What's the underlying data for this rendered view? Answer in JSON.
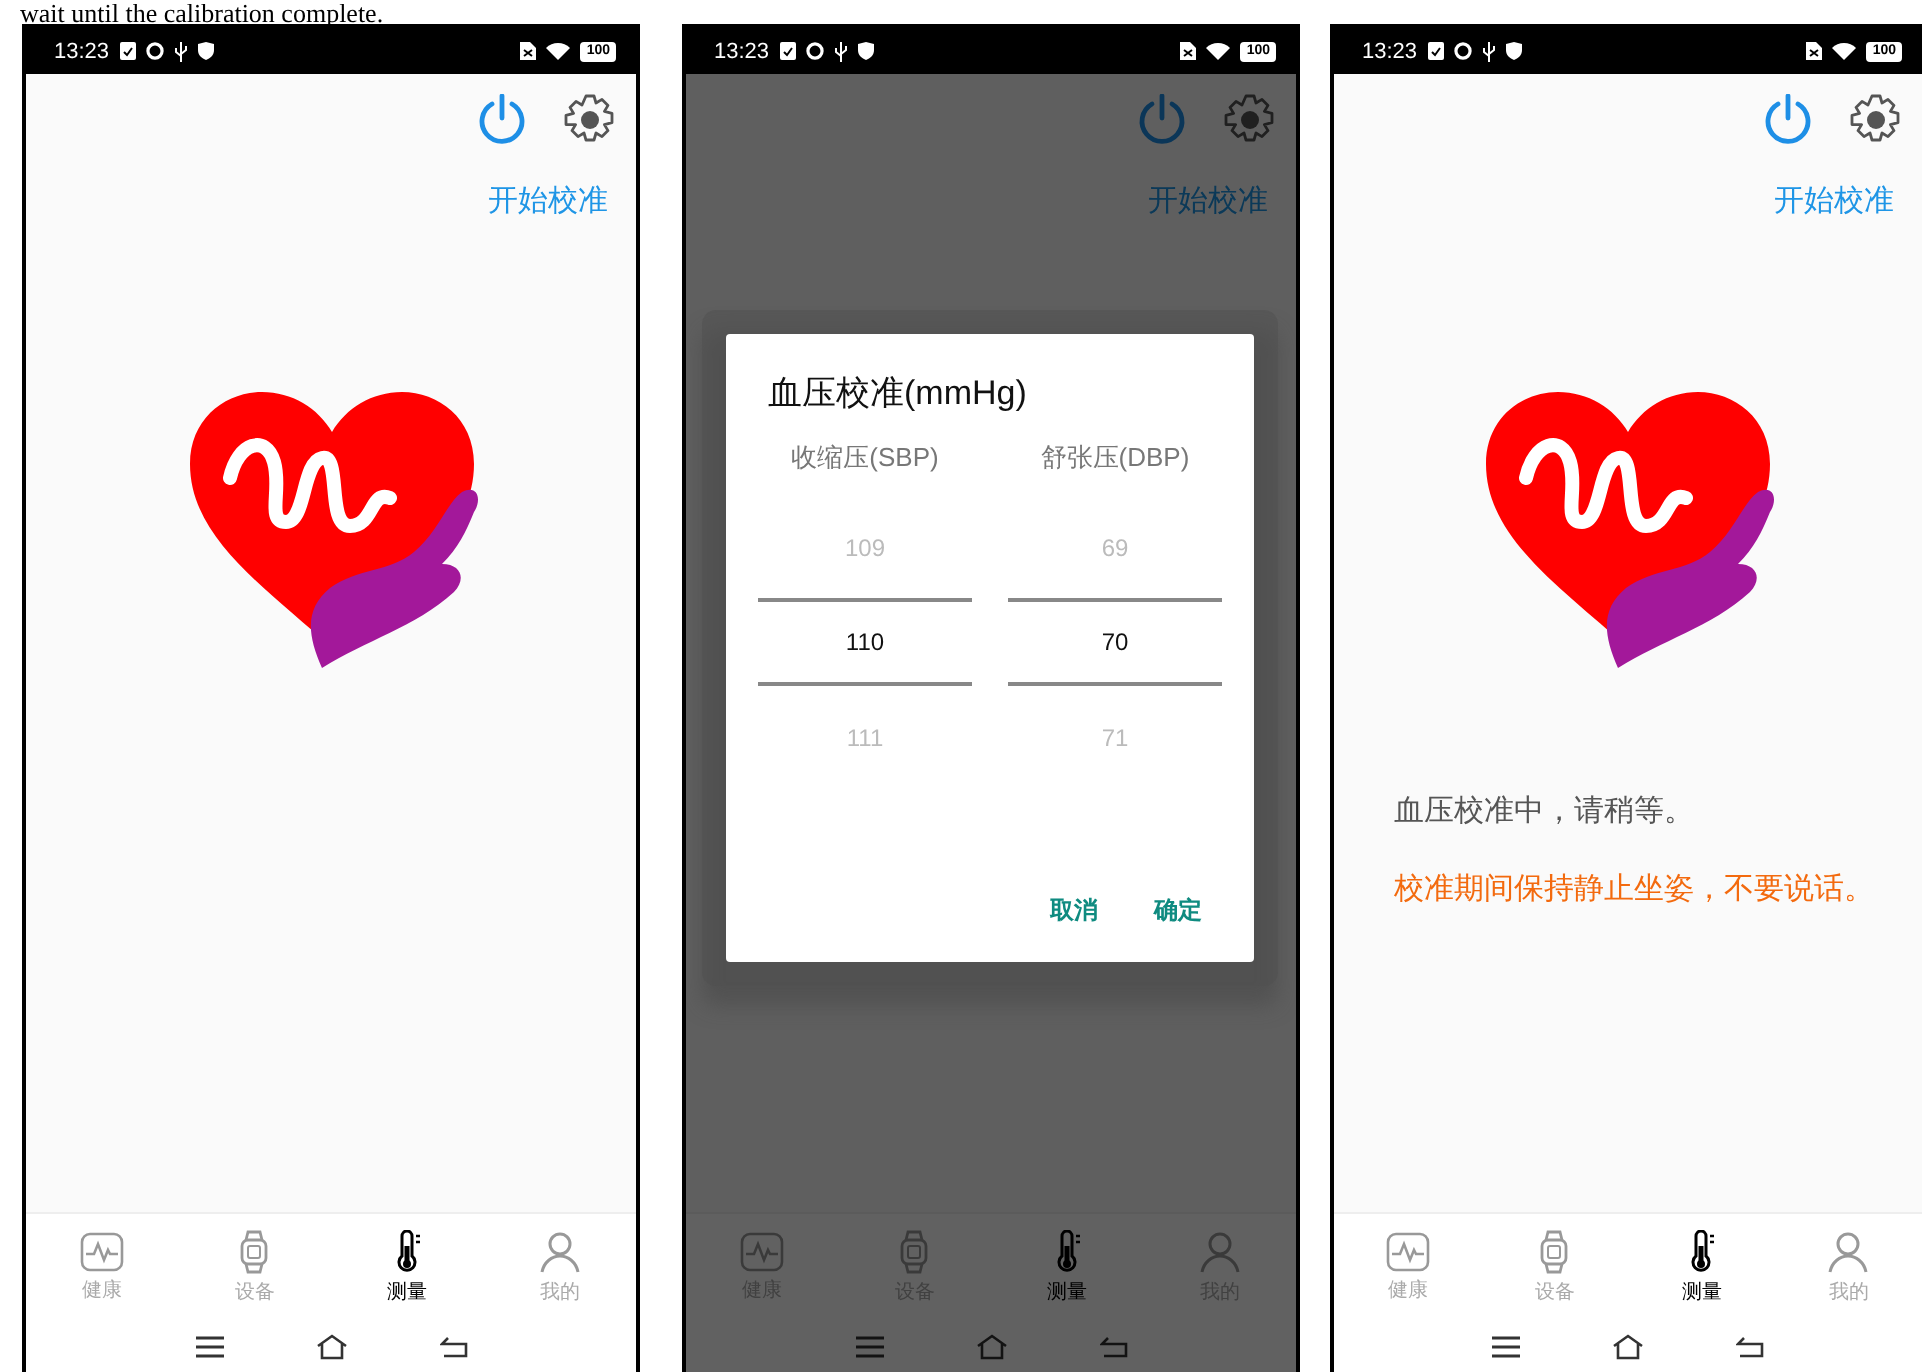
{
  "caption": "wait until the calibration complete.",
  "screens": [
    {
      "status_bar": {
        "time": "13:23",
        "battery": "100"
      },
      "start_button": "开始校准",
      "dimmed": false,
      "tabs": [
        {
          "label": "健康",
          "selected": false
        },
        {
          "label": "设备",
          "selected": false
        },
        {
          "label": "测量",
          "selected": true
        },
        {
          "label": "我的",
          "selected": false
        }
      ]
    },
    {
      "status_bar": {
        "time": "13:23",
        "battery": "100"
      },
      "start_button": "开始校准",
      "dimmed": true,
      "dialog": {
        "title": "血压校准(mmHg)",
        "columns": [
          {
            "label": "收缩压(SBP)",
            "above": "109",
            "value": "110",
            "below": "111"
          },
          {
            "label": "舒张压(DBP)",
            "above": "69",
            "value": "70",
            "below": "71"
          }
        ],
        "buttons": [
          "取消",
          "确定"
        ]
      },
      "tabs": [
        {
          "label": "健康",
          "selected": false
        },
        {
          "label": "设备",
          "selected": false
        },
        {
          "label": "测量",
          "selected": true
        },
        {
          "label": "我的",
          "selected": false
        }
      ]
    },
    {
      "status_bar": {
        "time": "13:23",
        "battery": "100"
      },
      "start_button": "开始校准",
      "dimmed": false,
      "messages": [
        {
          "kind": "info",
          "text": "血压校准中，请稍等。"
        },
        {
          "kind": "warning",
          "text": "校准期间保持静止坐姿，不要说话。"
        }
      ],
      "tabs": [
        {
          "label": "健康",
          "selected": false
        },
        {
          "label": "设备",
          "selected": false
        },
        {
          "label": "测量",
          "selected": true
        },
        {
          "label": "我的",
          "selected": false
        }
      ]
    }
  ]
}
